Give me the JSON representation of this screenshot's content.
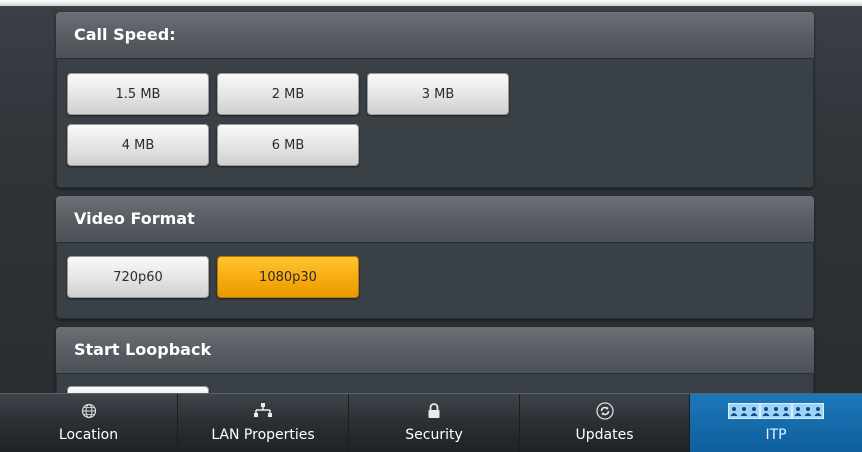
{
  "call_speed": {
    "title": "Call Speed:",
    "options": [
      "1.5 MB",
      "2 MB",
      "3 MB",
      "4 MB",
      "6 MB"
    ]
  },
  "video_format": {
    "title": "Video Format",
    "options": [
      "720p60",
      "1080p30"
    ],
    "selected": "1080p30"
  },
  "loopback": {
    "title": "Start Loopback"
  },
  "tabs": [
    {
      "label": "Location",
      "icon": "globe-icon"
    },
    {
      "label": "LAN Properties",
      "icon": "network-icon"
    },
    {
      "label": "Security",
      "icon": "lock-icon"
    },
    {
      "label": "Updates",
      "icon": "refresh-icon"
    },
    {
      "label": "ITP",
      "icon": "people-icon",
      "active": true
    }
  ],
  "colors": {
    "accent_selected": "#f6a90b",
    "tab_active": "#1c77b8"
  }
}
